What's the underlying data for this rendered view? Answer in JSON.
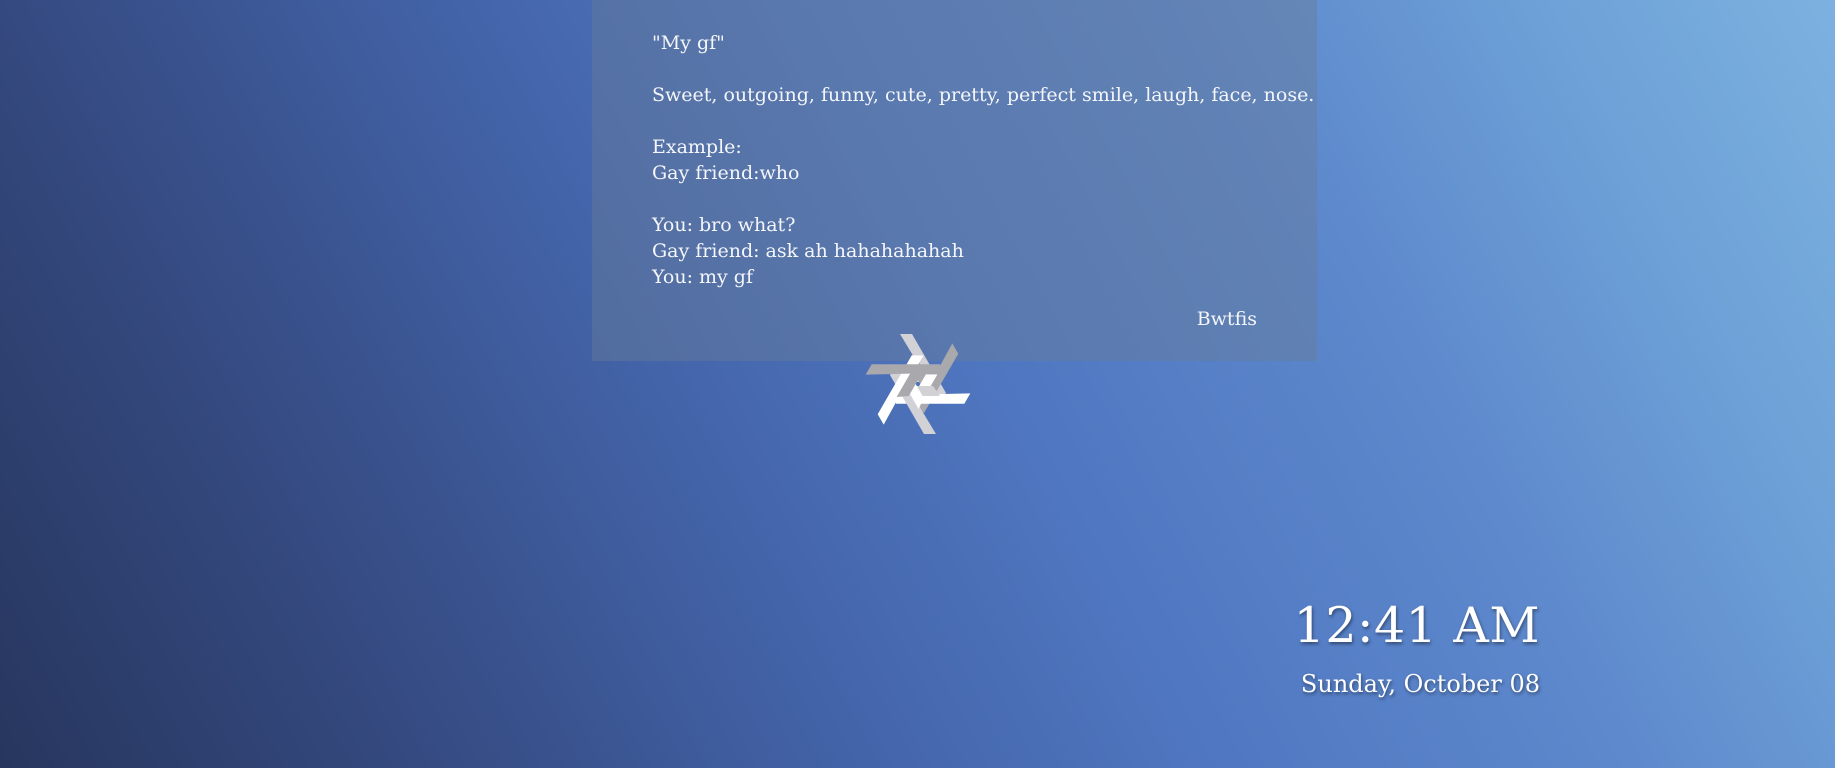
{
  "quote": {
    "lines": [
      "\"My gf\"",
      "",
      "Sweet, outgoing, funny, cute, pretty, perfect smile, laugh, face, nose.",
      "",
      "Example:",
      "Gay friend:who",
      "",
      "You: bro what?",
      "Gay friend: ask ah hahahahahah",
      "You: my gf"
    ],
    "author": "Bwtfis"
  },
  "logo": {
    "icon": "nixos-snowflake-icon",
    "colors": {
      "light": "#ffffff",
      "mid": "#d2d2d6",
      "dark": "#a8a8ad"
    }
  },
  "clock": {
    "time": "12:41 AM",
    "date": "Sunday, October 08"
  }
}
